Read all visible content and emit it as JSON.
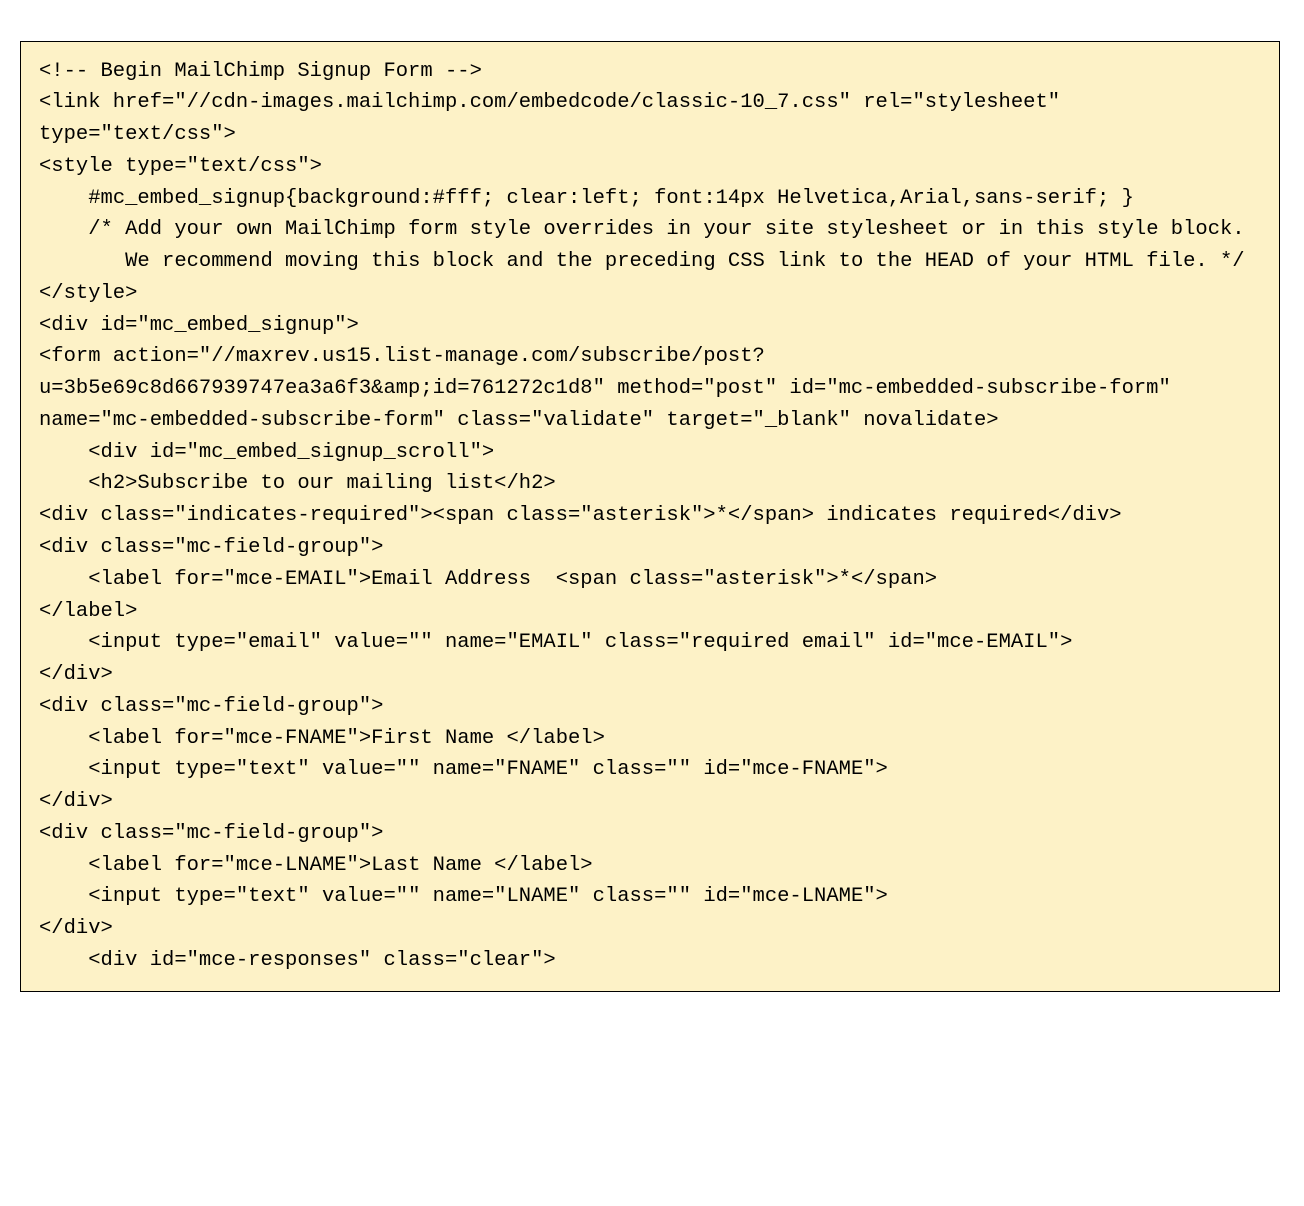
{
  "code": {
    "lines": [
      "<!-- Begin MailChimp Signup Form -->",
      "<link href=\"//cdn-images.mailchimp.com/embedcode/classic-10_7.css\" rel=\"stylesheet\" type=\"text/css\">",
      "<style type=\"text/css\">",
      "    #mc_embed_signup{background:#fff; clear:left; font:14px Helvetica,Arial,sans-serif; }",
      "    /* Add your own MailChimp form style overrides in your site stylesheet or in this style block.",
      "       We recommend moving this block and the preceding CSS link to the HEAD of your HTML file. */",
      "</style>",
      "<div id=\"mc_embed_signup\">",
      "<form action=\"//maxrev.us15.list-manage.com/subscribe/post?u=3b5e69c8d667939747ea3a6f3&amp;id=761272c1d8\" method=\"post\" id=\"mc-embedded-subscribe-form\" name=\"mc-embedded-subscribe-form\" class=\"validate\" target=\"_blank\" novalidate>",
      "    <div id=\"mc_embed_signup_scroll\">",
      "    <h2>Subscribe to our mailing list</h2>",
      "<div class=\"indicates-required\"><span class=\"asterisk\">*</span> indicates required</div>",
      "<div class=\"mc-field-group\">",
      "    <label for=\"mce-EMAIL\">Email Address  <span class=\"asterisk\">*</span>",
      "</label>",
      "    <input type=\"email\" value=\"\" name=\"EMAIL\" class=\"required email\" id=\"mce-EMAIL\">",
      "</div>",
      "<div class=\"mc-field-group\">",
      "    <label for=\"mce-FNAME\">First Name </label>",
      "    <input type=\"text\" value=\"\" name=\"FNAME\" class=\"\" id=\"mce-FNAME\">",
      "</div>",
      "<div class=\"mc-field-group\">",
      "    <label for=\"mce-LNAME\">Last Name </label>",
      "    <input type=\"text\" value=\"\" name=\"LNAME\" class=\"\" id=\"mce-LNAME\">",
      "</div>",
      "    <div id=\"mce-responses\" class=\"clear\">"
    ]
  }
}
